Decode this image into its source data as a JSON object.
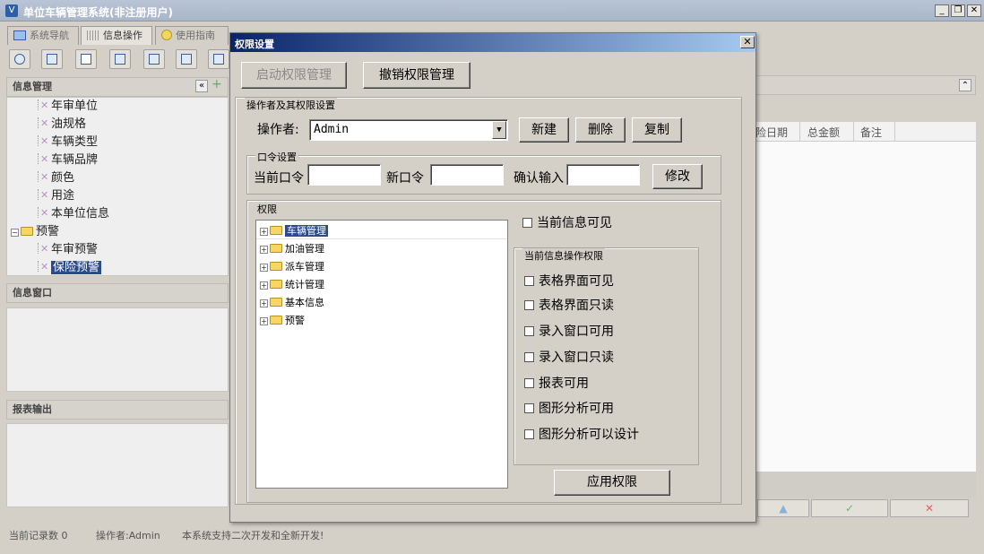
{
  "window": {
    "title": "单位车辆管理系统(非注册用户)",
    "app_icon": "V"
  },
  "tabs": [
    {
      "label": "系统导航",
      "active": false
    },
    {
      "label": "信息操作",
      "active": true
    },
    {
      "label": "使用指南",
      "active": false
    }
  ],
  "left": {
    "info_panel_title": "信息管理",
    "collapse_glyph": "«",
    "add_glyph": "+",
    "tree": [
      {
        "label": "年审单位",
        "type": "leaf"
      },
      {
        "label": "油规格",
        "type": "leaf"
      },
      {
        "label": "车辆类型",
        "type": "leaf"
      },
      {
        "label": "车辆品牌",
        "type": "leaf"
      },
      {
        "label": "颜色",
        "type": "leaf"
      },
      {
        "label": "用途",
        "type": "leaf"
      },
      {
        "label": "本单位信息",
        "type": "leaf"
      },
      {
        "label": "预警",
        "type": "folder"
      },
      {
        "label": "年审预警",
        "type": "leaf"
      },
      {
        "label": "保险预警",
        "type": "leaf",
        "selected": true
      }
    ],
    "info_window_title": "信息窗口",
    "report_title": "报表输出"
  },
  "right": {
    "columns": [
      "险日期",
      "总金额",
      "备注"
    ],
    "collapse_glyph": "⌃",
    "nav_buttons": [
      "▲",
      "✓",
      "✕"
    ]
  },
  "status": {
    "record_count": "当前记录数 0",
    "operator": "操作者:Admin",
    "message": "本系统支持二次开发和全新开发!"
  },
  "dialog": {
    "title": "权限设置",
    "close_glyph": "✕",
    "start_button": "启动权限管理",
    "revoke_button": "撤销权限管理",
    "operator_group": "操作者及其权限设置",
    "operator_label": "操作者:",
    "operator_value": "Admin",
    "new_button": "新建",
    "delete_button": "删除",
    "copy_button": "复制",
    "password_group": "口令设置",
    "current_password_label": "当前口令",
    "new_password_label": "新口令",
    "confirm_label": "确认输入",
    "modify_button": "修改",
    "permission_group": "权限",
    "perm_tree": [
      "车辆管理",
      "加油管理",
      "派车管理",
      "统计管理",
      "基本信息",
      "预警"
    ],
    "current_visible": "当前信息可见",
    "op_group": "当前信息操作权限",
    "ops": [
      "表格界面可见",
      "表格界面只读",
      "录入窗口可用",
      "录入窗口只读",
      "报表可用",
      "图形分析可用",
      "图形分析可以设计"
    ],
    "apply_button": "应用权限"
  }
}
